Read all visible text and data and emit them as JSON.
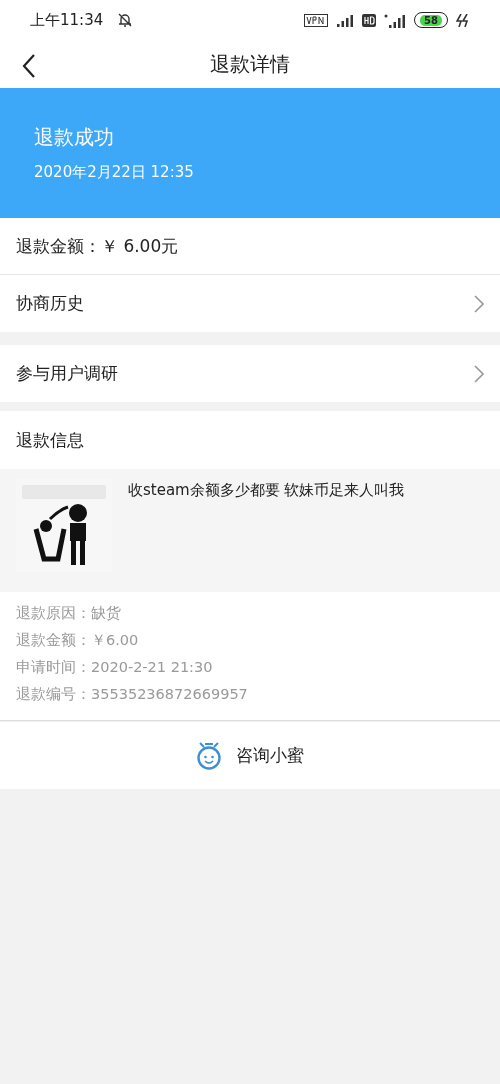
{
  "status_bar": {
    "time": "上午11:34",
    "battery": "58"
  },
  "nav": {
    "title": "退款详情"
  },
  "banner": {
    "status": "退款成功",
    "date": "2020年2月22日 12:35"
  },
  "amount_row": {
    "label": "退款金额：",
    "value": "￥ 6.00元"
  },
  "link_rows": [
    {
      "label": "协商历史"
    },
    {
      "label": "参与用户调研"
    }
  ],
  "refund_info": {
    "title": "退款信息",
    "product": {
      "name": "收steam余额多少都要 软妹币足来人叫我"
    },
    "details": [
      {
        "label": "退款原因：",
        "value": "缺货"
      },
      {
        "label": "退款金额：",
        "value": "￥6.00"
      },
      {
        "label": "申请时间：",
        "value": "2020-2-21 21:30"
      },
      {
        "label": "退款编号：",
        "value": "35535236872669957"
      }
    ]
  },
  "consult_button": {
    "label": "咨询小蜜"
  }
}
